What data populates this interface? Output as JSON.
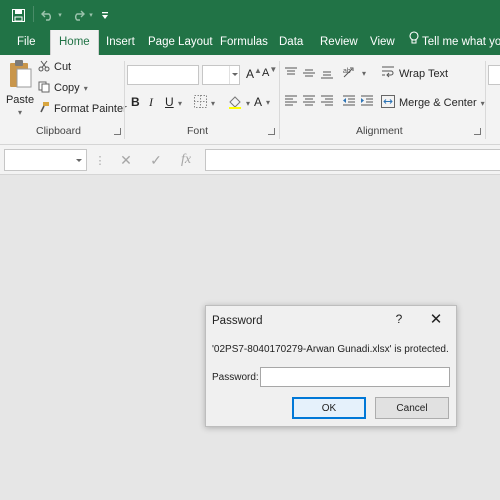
{
  "tabs": [
    "File",
    "Home",
    "Insert",
    "Page Layout",
    "Formulas",
    "Data",
    "Review",
    "View"
  ],
  "tell_me": "Tell me what you",
  "clipboard": {
    "paste": "Paste",
    "cut": "Cut",
    "copy": "Copy",
    "format_painter": "Format Painter",
    "label": "Clipboard"
  },
  "font": {
    "grow": "A",
    "shrink": "A",
    "bold": "B",
    "italic": "I",
    "underline": "U",
    "font_color": "A",
    "label": "Font"
  },
  "alignment": {
    "wrap_text": "Wrap Text",
    "merge_center": "Merge & Center",
    "label": "Alignment"
  },
  "formula_bar": {
    "fx": "fx"
  },
  "dialog": {
    "title": "Password",
    "help": "?",
    "message": "'02PS7-8040170279-Arwan Gunadi.xlsx' is protected.",
    "password_label": "Password:",
    "password_value": "",
    "ok": "OK",
    "cancel": "Cancel"
  },
  "colors": {
    "title_green": "#217346",
    "ribbon_bg": "#f3f3f3",
    "workspace_bg": "#e6e6e6",
    "default_button_border": "#0078d7"
  },
  "icons": [
    "save-icon",
    "undo-icon",
    "redo-icon",
    "customize-qat-icon",
    "lightbulb-icon",
    "paste-icon",
    "scissors-icon",
    "copy-icon",
    "paintbrush-icon",
    "border-icon",
    "fill-color-icon",
    "align-top-icon",
    "align-middle-icon",
    "align-bottom-icon",
    "orientation-icon",
    "align-left-icon",
    "align-center-icon",
    "align-right-icon",
    "decrease-indent-icon",
    "increase-indent-icon",
    "wrap-text-icon",
    "merge-center-icon",
    "cancel-entry-icon",
    "enter-icon",
    "close-icon"
  ]
}
